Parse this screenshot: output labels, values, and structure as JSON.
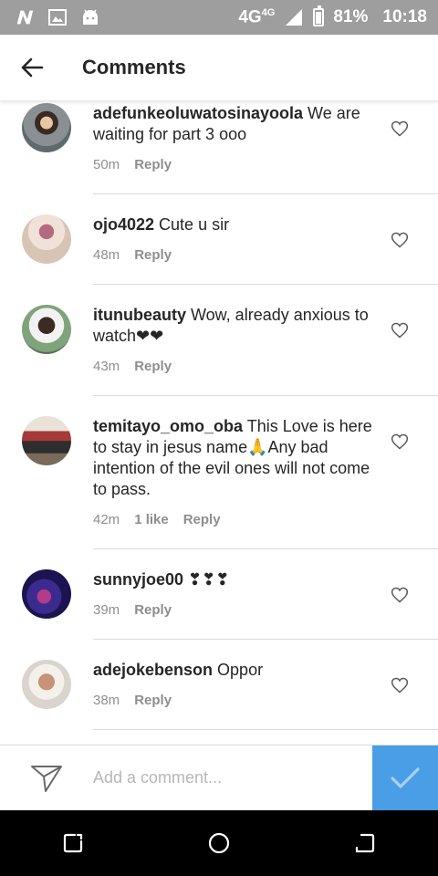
{
  "status_bar": {
    "network": "4G",
    "network_sup": "4G",
    "battery": "81%",
    "time": "10:18",
    "icons": [
      "n-logo-icon",
      "image-icon",
      "android-icon",
      "signal-icon",
      "battery-icon"
    ]
  },
  "app_bar": {
    "title": "Comments",
    "back_icon": "arrow-left-icon"
  },
  "comments": [
    {
      "username": "adefunkeoluwatosinayoola",
      "text": " We are waiting for part 3 ooo",
      "time": "50m",
      "likes": "",
      "reply": "Reply"
    },
    {
      "username": "ojo4022",
      "text": " Cute u sir",
      "time": "48m",
      "likes": "",
      "reply": "Reply"
    },
    {
      "username": "itunubeauty",
      "text": " Wow, already anxious to watch❤❤",
      "time": "43m",
      "likes": "",
      "reply": "Reply"
    },
    {
      "username": "temitayo_omo_oba",
      "text": " This Love is here to stay in jesus name🙏Any bad intention of the evil ones will not come to pass.",
      "time": "42m",
      "likes": "1 like",
      "reply": "Reply"
    },
    {
      "username": "sunnyjoe00",
      "text": " ❣❣❣",
      "time": "39m",
      "likes": "",
      "reply": "Reply"
    },
    {
      "username": "adejokebenson",
      "text": " Oppor",
      "time": "38m",
      "likes": "",
      "reply": "Reply"
    }
  ],
  "composer": {
    "placeholder": "Add a comment...",
    "send_icon": "paper-plane-icon",
    "post_icon": "checkmark-icon"
  },
  "nav_bar": {
    "icons": [
      "recent-apps-icon",
      "home-icon",
      "back-icon"
    ]
  },
  "colors": {
    "status_bar": "#9e9e9e",
    "post_button": "#4a9ee6",
    "meta_text": "#8e8e8e",
    "divider": "#dbdbdb"
  }
}
